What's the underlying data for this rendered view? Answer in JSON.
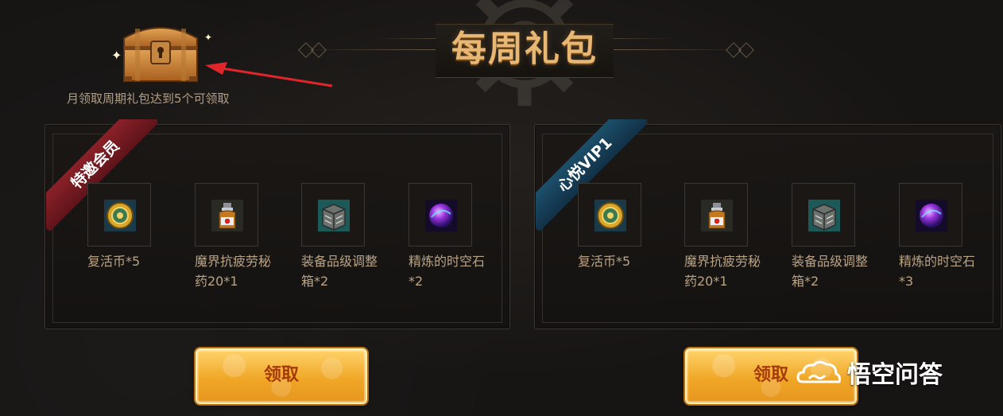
{
  "header": {
    "title": "每周礼包"
  },
  "chest": {
    "note": "月领取周期礼包达到5个可领取"
  },
  "panels": [
    {
      "ribbon": "特邀会员",
      "ribbon_color": "#7a1c23",
      "items": [
        {
          "icon": "revive-coin-icon",
          "name": "复活币*5"
        },
        {
          "icon": "fatigue-potion-icon",
          "name": "魔界抗疲劳秘药20*1"
        },
        {
          "icon": "equipment-grade-box-icon",
          "name": "装备品级调整箱*2"
        },
        {
          "icon": "refined-spacetime-stone-icon",
          "name": "精炼的时空石*2"
        }
      ],
      "button": "领取"
    },
    {
      "ribbon": "心悦VIP1",
      "ribbon_color": "#173f58",
      "items": [
        {
          "icon": "revive-coin-icon",
          "name": "复活币*5"
        },
        {
          "icon": "fatigue-potion-icon",
          "name": "魔界抗疲劳秘药20*1"
        },
        {
          "icon": "equipment-grade-box-icon",
          "name": "装备品级调整箱*2"
        },
        {
          "icon": "refined-spacetime-stone-icon",
          "name": "精炼的时空石*3"
        }
      ],
      "button": "领取"
    }
  ],
  "watermark": {
    "text": "悟空问答"
  },
  "colors": {
    "title": "#e9b774",
    "button": "#f0a727",
    "button_text": "#a53b0c",
    "text": "#b9a387"
  }
}
